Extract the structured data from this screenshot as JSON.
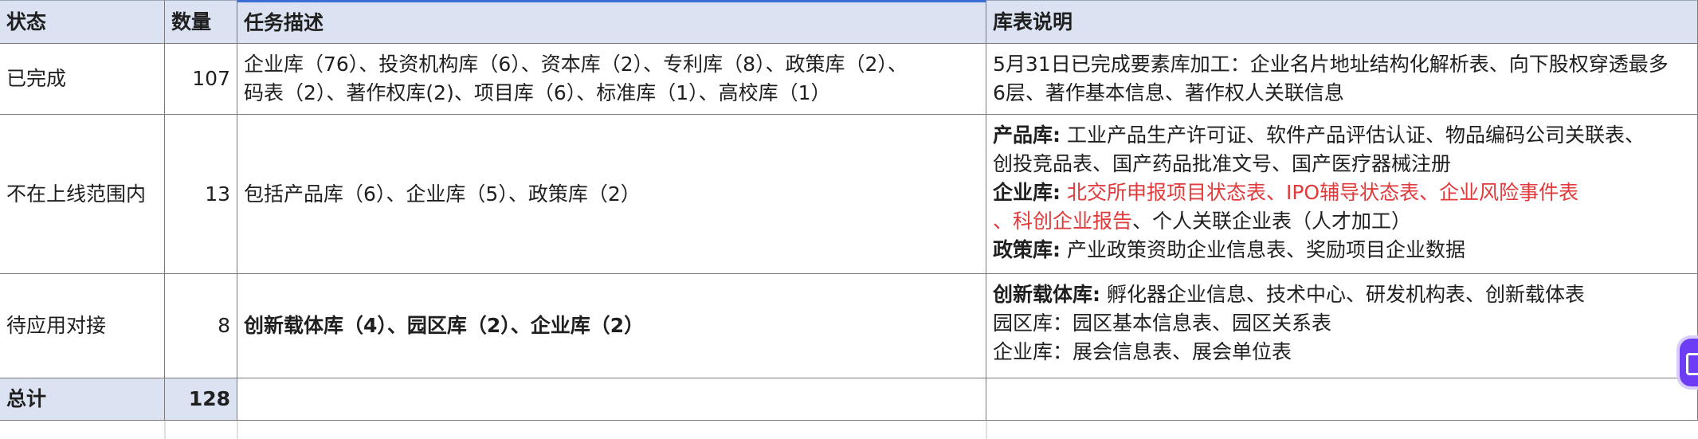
{
  "headers": {
    "status": "状态",
    "count": "数量",
    "task": "任务描述",
    "note": "库表说明"
  },
  "rows": [
    {
      "status": "已完成",
      "count": "107",
      "task_lines": [
        "企业库（76）、投资机构库（6）、资本库（2）、专利库（8）、政策库（2）、",
        "码表（2）、著作权库(2)、项目库（6）、标准库（1）、高校库（1）"
      ],
      "note_lines": [
        "5月31日已完成要素库加工：企业名片地址结构化解析表、向下股权穿透最多",
        "6层、著作基本信息、著作权人关联信息"
      ]
    },
    {
      "status": "不在上线范围内",
      "count": "13",
      "task": "包括产品库（6）、企业库（5）、政策库（2）",
      "note": {
        "product_label": "产品库:",
        "product_text_1": "工业产品生产许可证、软件产品评估认证、物品编码公司关联表、",
        "product_text_2": "创投竞品表、国产药品批准文号、国产医疗器械注册",
        "enterprise_label": "企业库:",
        "enterprise_red_1": "北交所申报项目状态表、IPO辅导状态表、企业风险事件表",
        "enterprise_red_2": "、科创企业报告",
        "enterprise_text": "、个人关联企业表（人才加工）",
        "policy_label": "政策库:",
        "policy_text": "产业政策资助企业信息表、奖励项目企业数据"
      }
    },
    {
      "status": "待应用对接",
      "count": "8",
      "task": "创新载体库（4）、园区库（2）、企业库（2）",
      "note": {
        "carrier_label": "创新载体库:",
        "carrier_text": "孵化器企业信息、技术中心、研发机构表、创新载体表",
        "park_line": "园区库：园区基本信息表、园区关系表",
        "enterprise_line": "企业库：展会信息表、展会单位表"
      }
    }
  ],
  "total": {
    "label": "总计",
    "count": "128"
  },
  "colors": {
    "header_bg": "#dbe3f2",
    "red_text": "#e03a3a",
    "floating_button": "#6d3df5"
  }
}
